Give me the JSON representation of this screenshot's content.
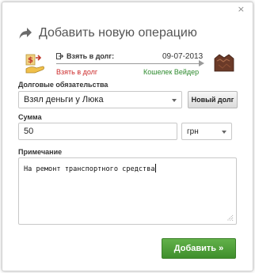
{
  "dialog": {
    "close_label": "×",
    "title": "Добавить новую операцию"
  },
  "operation": {
    "type_label": "Взять в долг:",
    "date": "09-07-2013",
    "from_name": "Взять в долг",
    "to_name": "Кошелек Вейдер"
  },
  "debt": {
    "label": "Долговые обязательства",
    "selected": "Взял деньги у Люка",
    "new_button": "Новый долг"
  },
  "amount": {
    "label": "Сумма",
    "value": "50",
    "currency": "грн"
  },
  "note": {
    "label": "Примечание",
    "value": "На ремонт транспортного средства"
  },
  "submit_label": "Добавить »",
  "colors": {
    "from": "#cc2a2a",
    "to": "#2d8a2d",
    "submit": "#4fa03a"
  },
  "icons": {
    "title": "share-arrow-icon",
    "source": "money-hand-icon",
    "target": "wallet-icon"
  }
}
